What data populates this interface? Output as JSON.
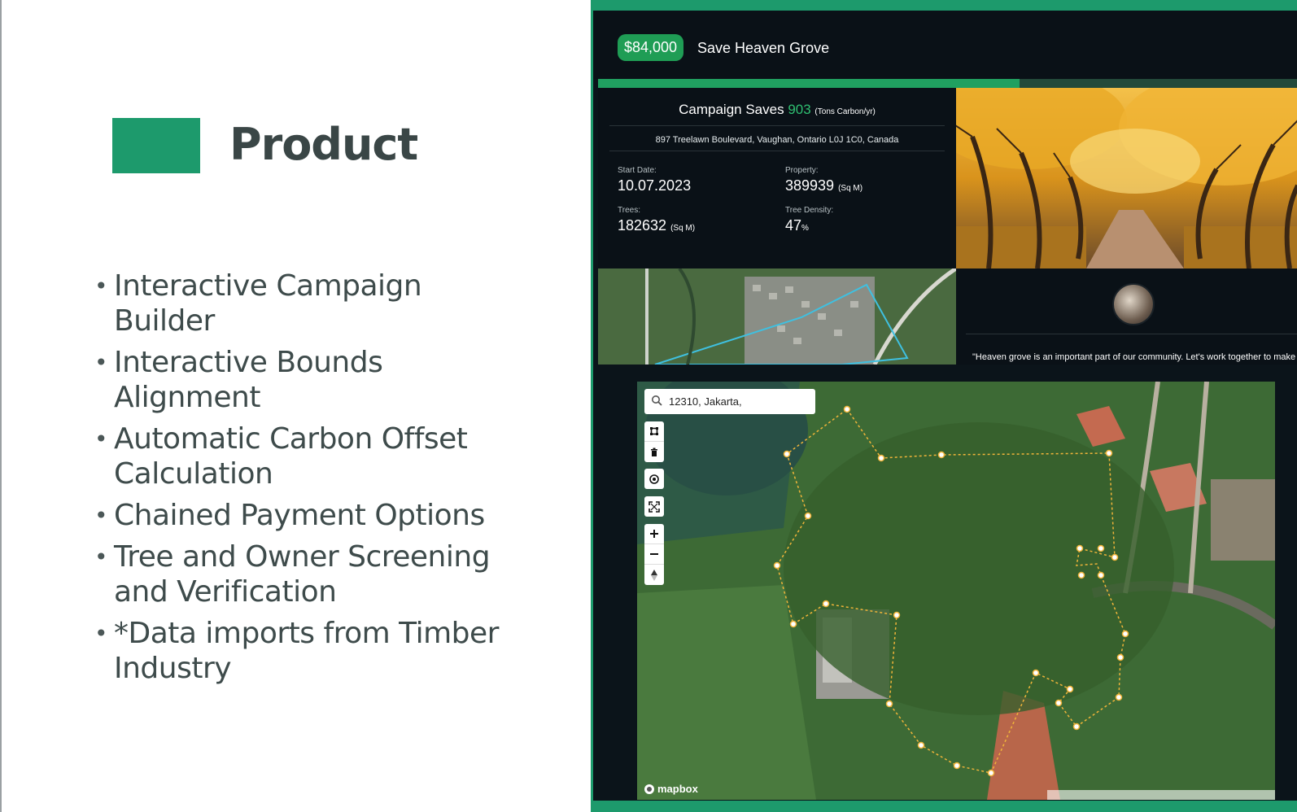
{
  "slide": {
    "title": "Product",
    "bullets": [
      "Interactive Campaign Builder",
      "Interactive Bounds Alignment",
      "Automatic Carbon Offset Calculation",
      "Chained Payment Options",
      "Tree and Owner Screening and Verification",
      "*Data imports from Timber Industry"
    ],
    "accent_color": "#1d9a6c"
  },
  "app": {
    "amount": "$84,000",
    "campaign_name": "Save Heaven Grove",
    "progress_fraction": 0.6,
    "stats": {
      "title_prefix": "Campaign Saves",
      "carbon_value": "903",
      "carbon_unit": "(Tons Carbon/yr)",
      "address": "897 Treelawn Boulevard, Vaughan, Ontario L0J 1C0, Canada",
      "start_date_label": "Start Date:",
      "start_date": "10.07.2023",
      "property_label": "Property:",
      "property_value": "389939",
      "property_unit": "(Sq M)",
      "trees_label": "Trees:",
      "trees_value": "182632",
      "trees_unit": "(Sq M)",
      "density_label": "Tree Density:",
      "density_value": "47",
      "density_unit": "%"
    },
    "quote": "\"Heaven grove is an important part of our community. Let's work together to make",
    "map": {
      "search_value": "12310, Jakarta,",
      "logo_text": "mapbox",
      "controls": [
        "polygon-draw-icon",
        "trash-icon",
        "locate-icon",
        "fullscreen-icon",
        "zoom-in-icon",
        "zoom-out-icon",
        "compass-icon"
      ]
    }
  }
}
